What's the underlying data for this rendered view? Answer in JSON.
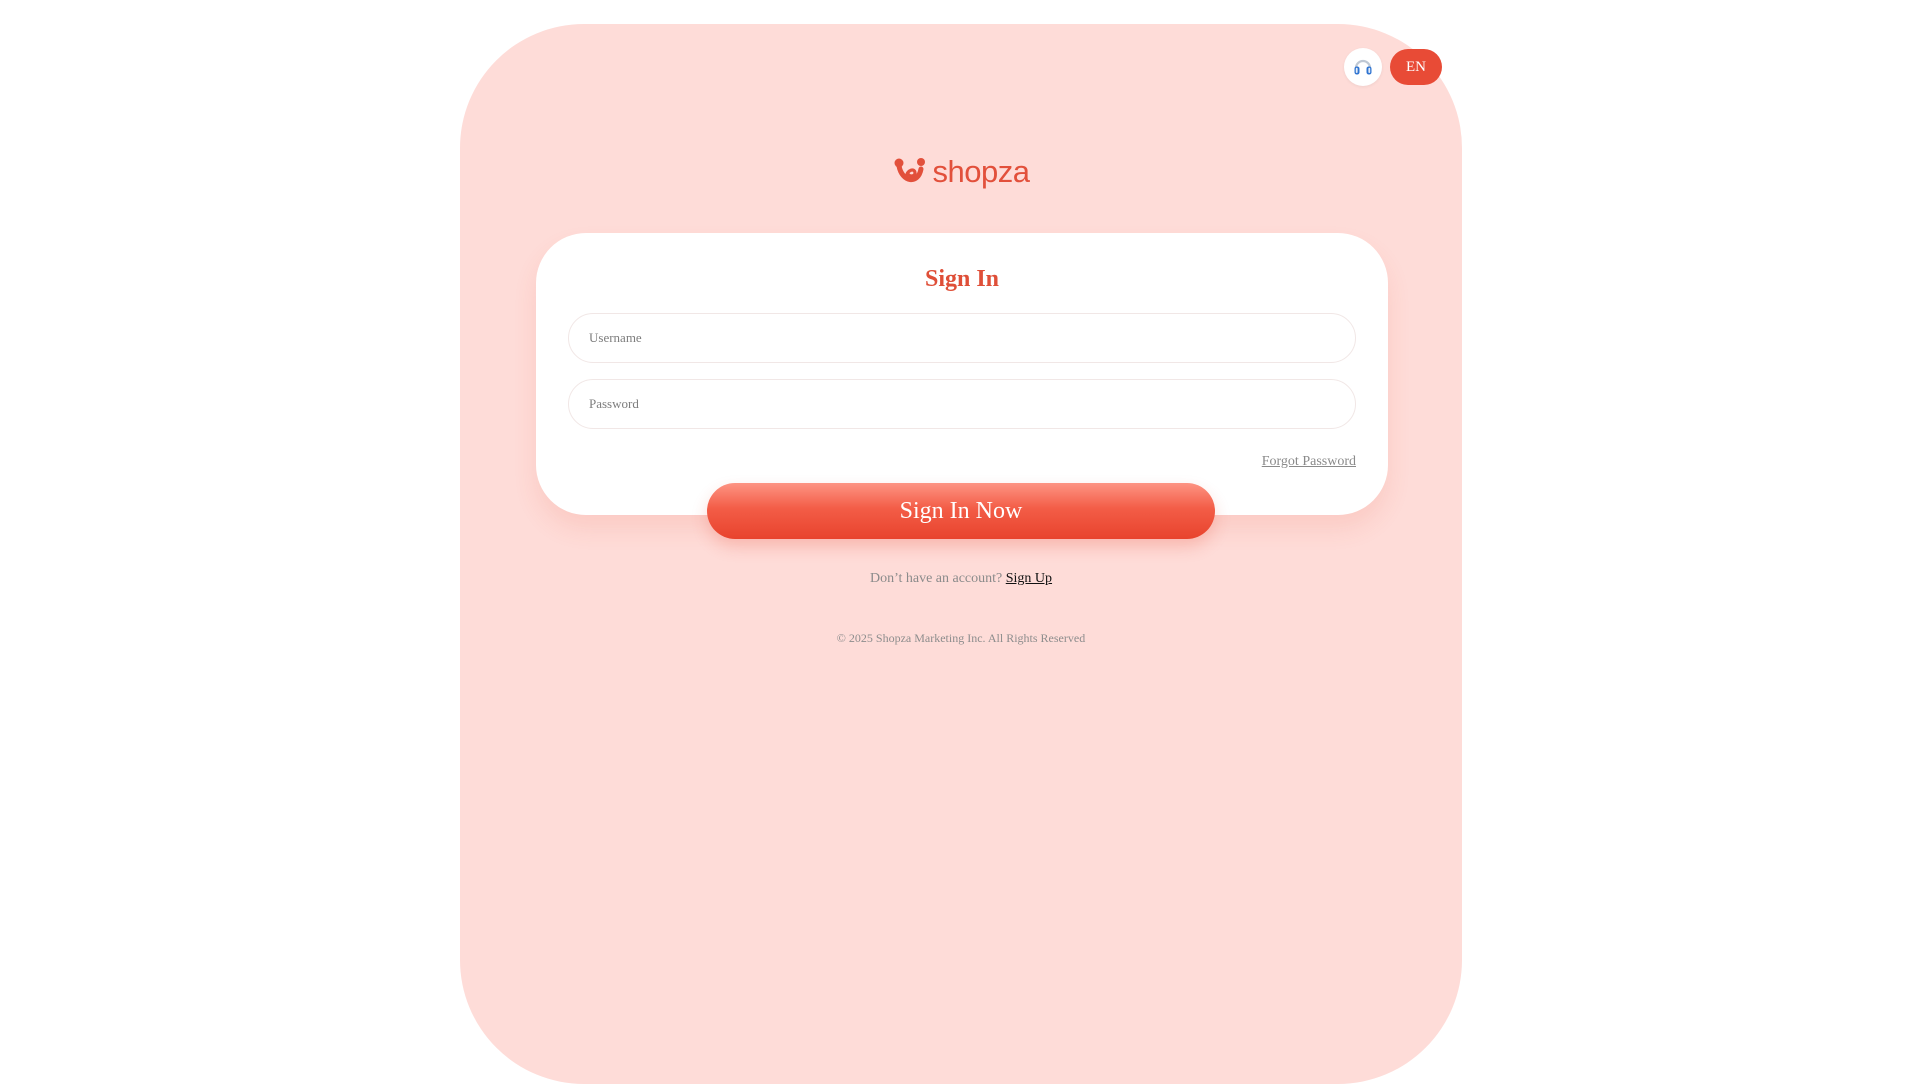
{
  "top_bar": {
    "language_label": "EN"
  },
  "brand": {
    "name": "shopza"
  },
  "login_card": {
    "title": "Sign In",
    "username_placeholder": "Username",
    "password_placeholder": "Password",
    "forgot_password_label": "Forgot Password",
    "submit_label": "Sign In Now"
  },
  "signup": {
    "prompt": "Don’t have an account?",
    "link_label": "Sign Up"
  },
  "footer": {
    "copyright": "© 2025 Shopza Marketing Inc. All Rights Reserved"
  },
  "colors": {
    "page_background": "#ffffff",
    "panel_background": "#fedcd8",
    "accent": "#e84b36",
    "title": "#df4f38",
    "card_background": "#ffffff",
    "support_icon": "#2f74d1"
  },
  "icons": {
    "support": "headset-icon",
    "logo": "shopza-logo-icon"
  }
}
